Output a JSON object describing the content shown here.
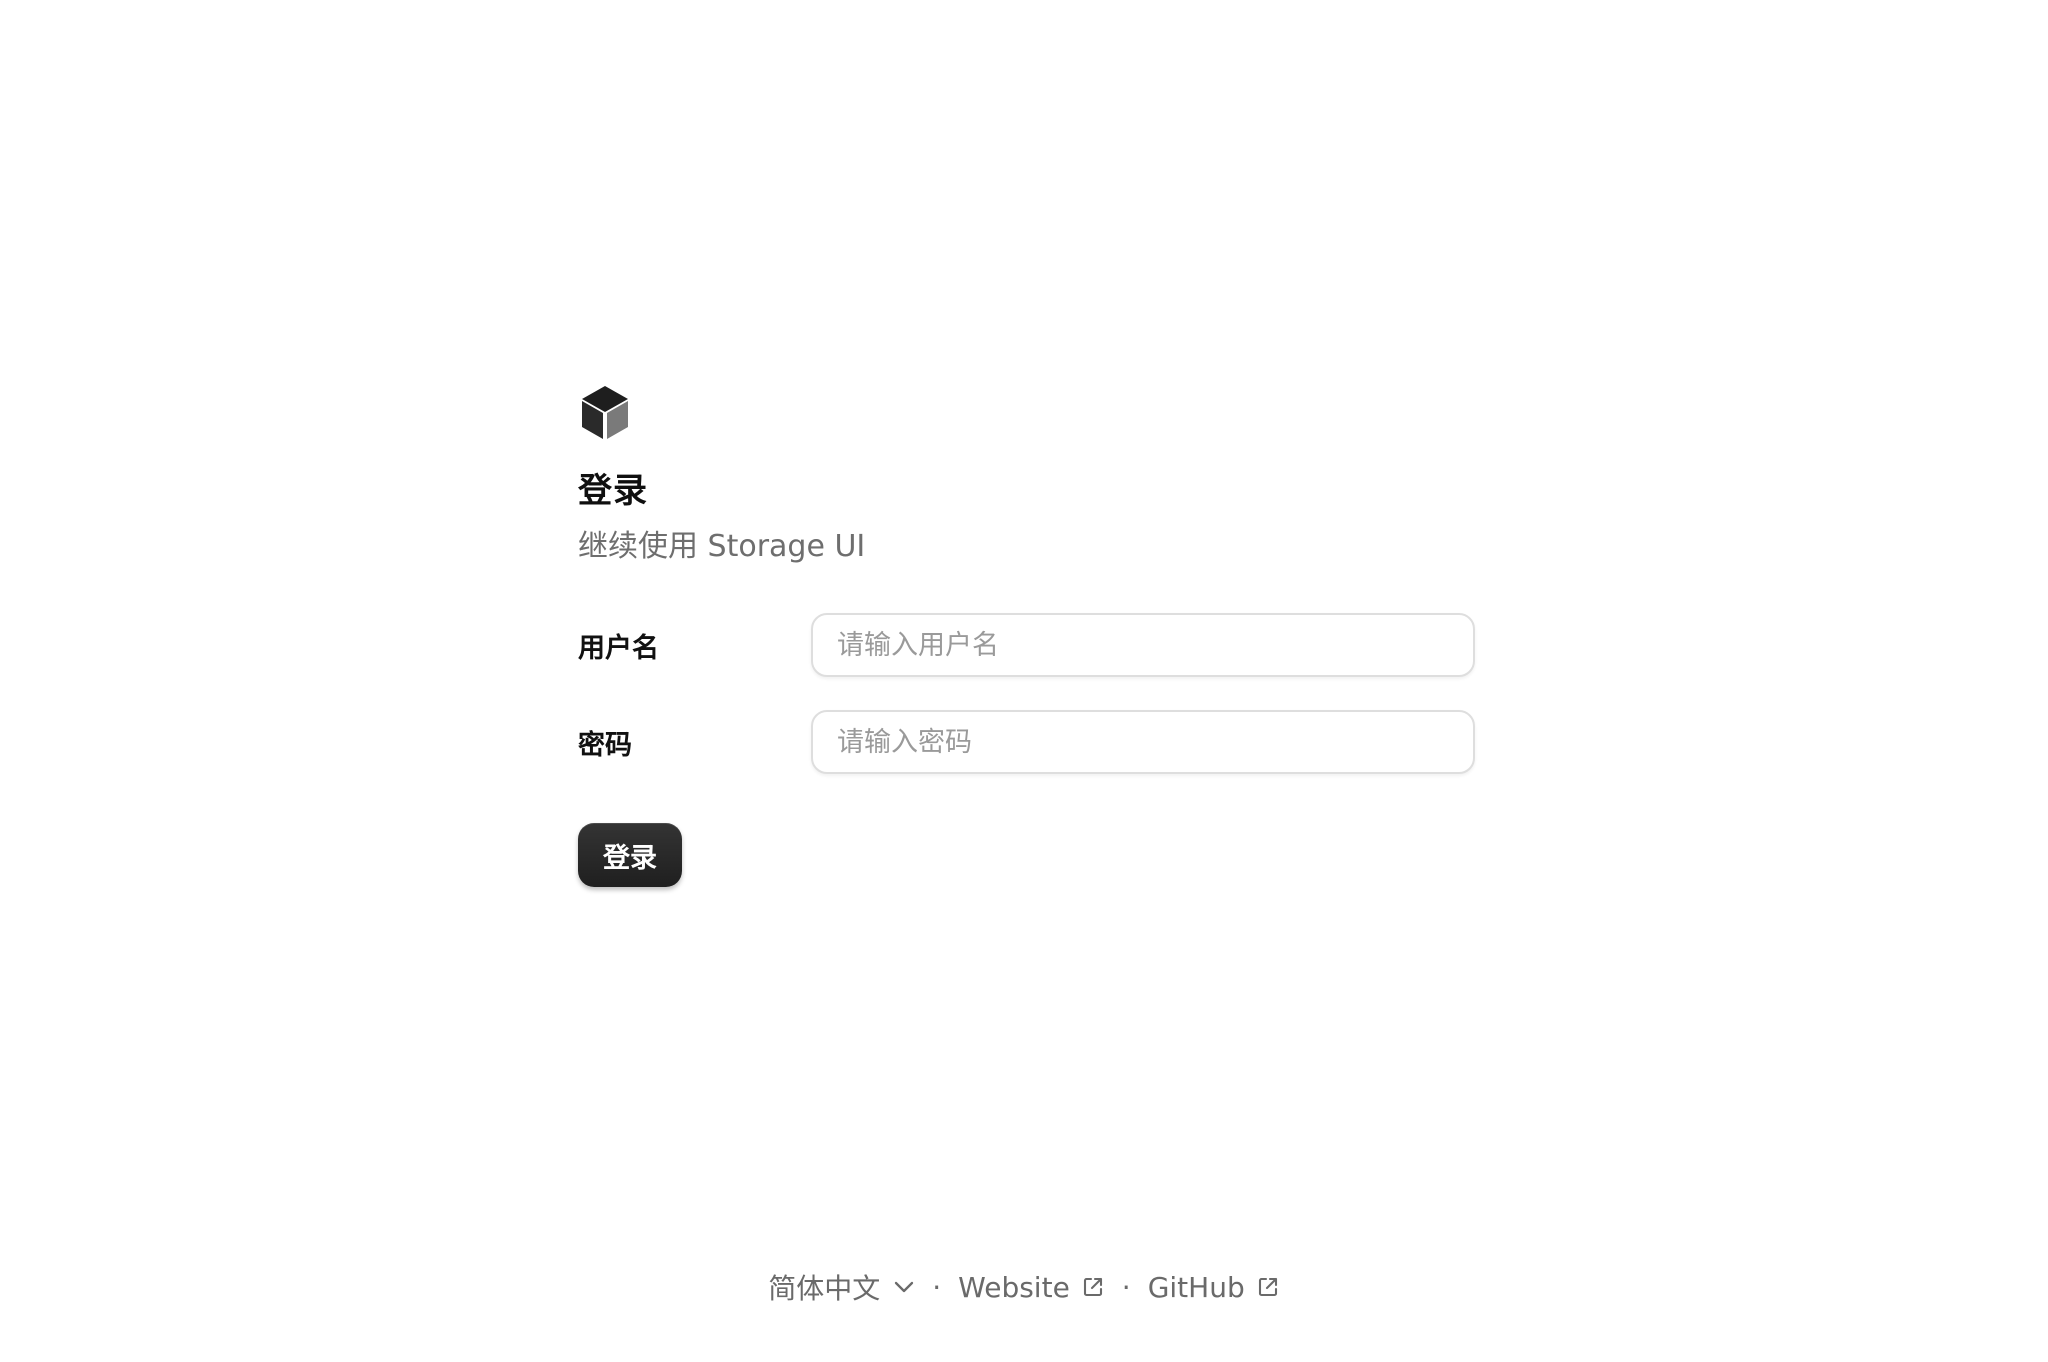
{
  "login": {
    "title": "登录",
    "subtitle": "继续使用 Storage UI",
    "username": {
      "label": "用户名",
      "placeholder": "请输入用户名",
      "value": ""
    },
    "password": {
      "label": "密码",
      "placeholder": "请输入密码",
      "value": ""
    },
    "submit_label": "登录"
  },
  "footer": {
    "language": "简体中文",
    "separator": "·",
    "website": "Website",
    "github": "GitHub"
  },
  "icons": {
    "logo": "cube-icon",
    "language_toggle": "chevron-down-icon",
    "external_link": "external-link-icon"
  },
  "colors": {
    "primary_button": "#262626",
    "text_primary": "#111111",
    "text_secondary": "#6e6e6e",
    "input_border": "#dedede"
  }
}
